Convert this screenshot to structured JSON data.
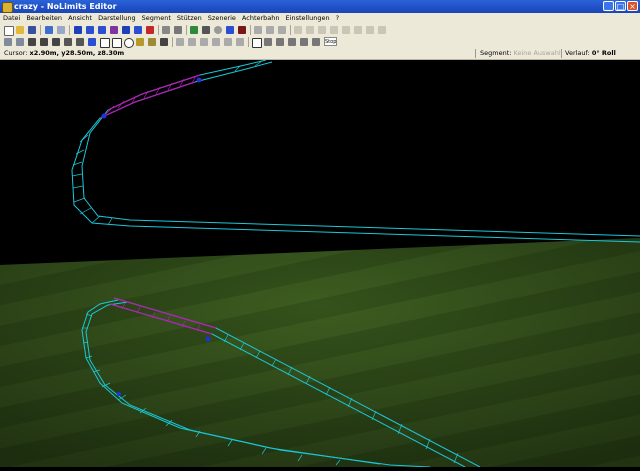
{
  "window": {
    "title": "crazy - NoLimits Editor"
  },
  "menu": [
    "Datei",
    "Bearbeiten",
    "Ansicht",
    "Darstellung",
    "Segment",
    "Stützen",
    "Szenerie",
    "Achterbahn",
    "Einstellungen",
    "?"
  ],
  "toolbar": {
    "stop_label": "Stop"
  },
  "status": {
    "cursor_label": "Cursor:",
    "cursor_value": "x2.90m, y28.50m, z8.30m",
    "segment_label": "Segment:",
    "segment_value": "Keine Auswahl",
    "verlauf_label": "Verlauf:",
    "verlauf_value": "0° Roll"
  },
  "colors": {
    "sky": "#000000",
    "grass": "#3a5a1f",
    "rail": "#19c8d8",
    "selected_rail": "#b51fb5",
    "node": "#2033d9"
  }
}
